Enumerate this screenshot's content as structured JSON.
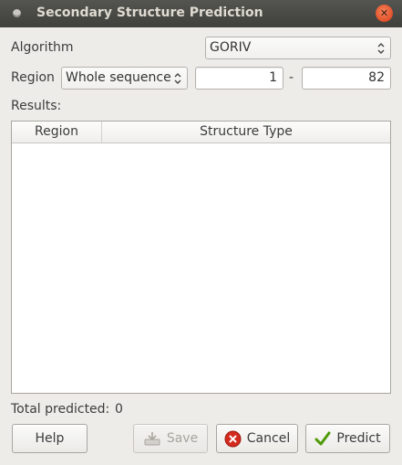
{
  "window": {
    "title": "Secondary Structure Prediction",
    "close_glyph": "✕",
    "icons": {
      "app": "app-dot-icon",
      "close": "close-icon"
    }
  },
  "algorithm": {
    "label": "Algorithm",
    "selected": "GORIV"
  },
  "region": {
    "label": "Region",
    "selected": "Whole sequence",
    "from": "1",
    "separator": "-",
    "to": "82"
  },
  "results": {
    "label": "Results:",
    "columns": [
      "Region",
      "Structure Type"
    ],
    "rows": []
  },
  "total": {
    "label": "Total predicted:",
    "value": "0"
  },
  "buttons": {
    "help": "Help",
    "save": "Save",
    "cancel": "Cancel",
    "predict": "Predict"
  },
  "colors": {
    "titlebar": "#3f403c",
    "window_bg": "#edece9",
    "close_accent": "#e0512a",
    "cancel_icon": "#d42a1e",
    "predict_icon": "#4e9a06"
  }
}
